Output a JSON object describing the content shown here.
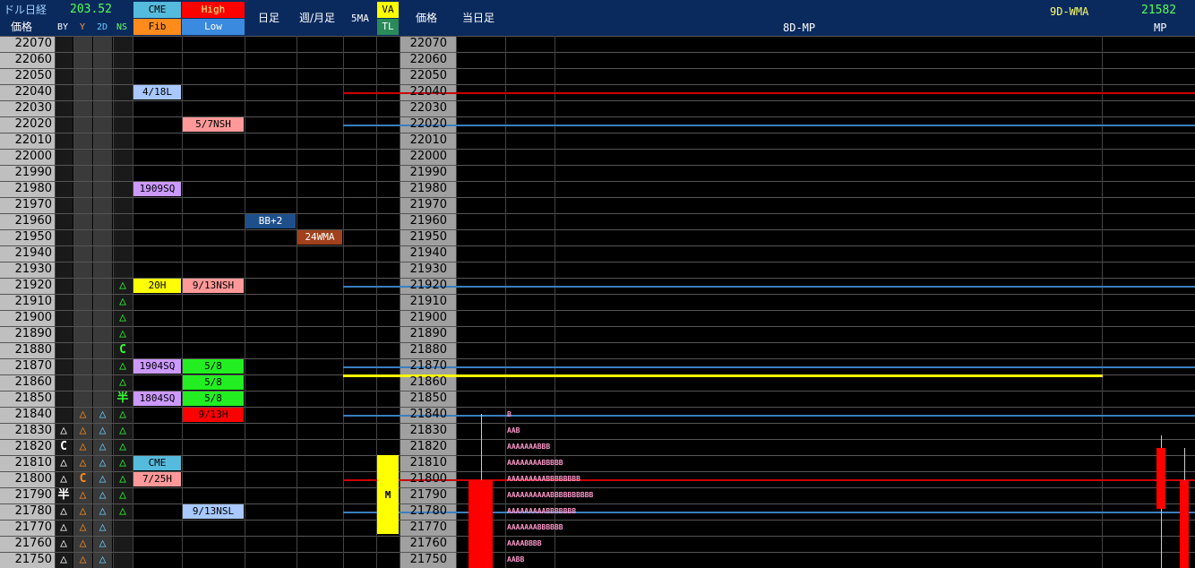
{
  "header": {
    "title": "ドル日経",
    "price_label": "価格",
    "top_value": "203.52",
    "col_by": "BY",
    "col_y": "Y",
    "col_2d": "2D",
    "col_ns": "NS",
    "cme": "CME",
    "fib": "Fib",
    "high": "High",
    "low": "Low",
    "daily": "日足",
    "weekly_monthly": "週/月足",
    "ma5": "5MA",
    "va": "VA",
    "tl": "TL",
    "price_label2": "価格",
    "current_day": "当日足",
    "mp8d": "8D-MP",
    "wma9d": "9D-WMA",
    "wma_value": "21582",
    "mp": "MP"
  },
  "colors": {
    "header_bg": "#0a2a5e",
    "price_col_bg": "#bfbfbf",
    "price2_bg": "#a0a0a0",
    "pink": "#ff9999",
    "lavender": "#cc99ff",
    "lightblue": "#a8c8ff",
    "green": "#22ee22",
    "red": "#ff0000",
    "yellow": "#ffff00",
    "cyan": "#55bbdd"
  },
  "prices": [
    "22070",
    "22060",
    "22050",
    "22040",
    "22030",
    "22020",
    "22010",
    "22000",
    "21990",
    "21980",
    "21970",
    "21960",
    "21950",
    "21940",
    "21930",
    "21920",
    "21910",
    "21900",
    "21890",
    "21880",
    "21870",
    "21860",
    "21850",
    "21840",
    "21830",
    "21820",
    "21810",
    "21800",
    "21790",
    "21780",
    "21770",
    "21760",
    "21750"
  ],
  "markers": {
    "by": {
      "21830": "△",
      "21820": "C",
      "21810": "△",
      "21800": "△",
      "21790": "半",
      "21780": "△",
      "21770": "△",
      "21760": "△",
      "21750": "△"
    },
    "y": {
      "21840": "△",
      "21830": "△",
      "21820": "△",
      "21810": "△",
      "21800": "C",
      "21790": "△",
      "21780": "△",
      "21770": "△",
      "21760": "△",
      "21750": "△"
    },
    "d2": {
      "21840": "△",
      "21830": "△",
      "21820": "△",
      "21810": "△",
      "21800": "△",
      "21790": "△",
      "21780": "△",
      "21770": "△",
      "21760": "△",
      "21750": "△"
    },
    "ns": {
      "21920": "△",
      "21910": "△",
      "21900": "△",
      "21890": "△",
      "21880": "C",
      "21870": "△",
      "21860": "△",
      "21850": "半",
      "21840": "△",
      "21830": "△",
      "21820": "△",
      "21810": "△",
      "21800": "△",
      "21790": "△",
      "21780": "△"
    }
  },
  "cme_fib": [
    {
      "price": "22040",
      "text": "4/18L",
      "color": "#a8c8ff"
    },
    {
      "price": "21980",
      "text": "1909SQ",
      "color": "#cc99ff"
    },
    {
      "price": "21920",
      "text": "20H",
      "color": "#ffff00"
    },
    {
      "price": "21870",
      "text": "1904SQ",
      "color": "#cc99ff"
    },
    {
      "price": "21850",
      "text": "1804SQ",
      "color": "#cc99ff"
    },
    {
      "price": "21810",
      "text": "CME",
      "color": "#55bbdd"
    },
    {
      "price": "21800",
      "text": "7/25H",
      "color": "#ff9999"
    }
  ],
  "high_low": [
    {
      "price": "22020",
      "text": "5/7NSH",
      "color": "#ff9999"
    },
    {
      "price": "21920",
      "text": "9/13NSH",
      "color": "#ff9999"
    },
    {
      "price": "21870",
      "text": "5/8",
      "color": "#22ee22"
    },
    {
      "price": "21860",
      "text": "5/8",
      "color": "#22ee22"
    },
    {
      "price": "21850",
      "text": "5/8",
      "color": "#22ee22"
    },
    {
      "price": "21840",
      "text": "9/13H",
      "color": "#ff0000"
    },
    {
      "price": "21780",
      "text": "9/13NSL",
      "color": "#a8c8ff"
    }
  ],
  "daily_marks": [
    {
      "price": "21960",
      "text": "BB+2",
      "color": "#1e4f8a"
    }
  ],
  "weekly_marks": [
    {
      "price": "21950",
      "text": "24WMA",
      "color": "#a0401c"
    }
  ],
  "va_marks": [
    {
      "price": "21790",
      "text": "M"
    }
  ],
  "tpo": [
    {
      "price": "21840",
      "text": "B"
    },
    {
      "price": "21830",
      "text": "AAB"
    },
    {
      "price": "21820",
      "text": "AAAAAAABBB"
    },
    {
      "price": "21810",
      "text": "AAAAAAAABBBBB"
    },
    {
      "price": "21800",
      "text": "AAAAAAAAABBBBBBBB"
    },
    {
      "price": "21790",
      "text": "AAAAAAAAAABBBBBBBBBB"
    },
    {
      "price": "21780",
      "text": "AAAAAAAAABBBBBBB"
    },
    {
      "price": "21770",
      "text": "AAAAAAABBBBBB"
    },
    {
      "price": "21760",
      "text": "AAAABBBB"
    },
    {
      "price": "21750",
      "text": "AABB"
    }
  ],
  "levels": [
    {
      "price": "22040",
      "color": "#cc0000"
    },
    {
      "price": "22020",
      "color": "#3a7fc0"
    },
    {
      "price": "21920",
      "color": "#3a7fc0"
    },
    {
      "price": "21870",
      "color": "#3a7fc0"
    },
    {
      "price": "21865",
      "color": "#ffff00"
    },
    {
      "price": "21840",
      "color": "#3a7fc0"
    },
    {
      "price": "21800",
      "color": "#cc0000"
    },
    {
      "price": "21780",
      "color": "#3a7fc0"
    }
  ]
}
